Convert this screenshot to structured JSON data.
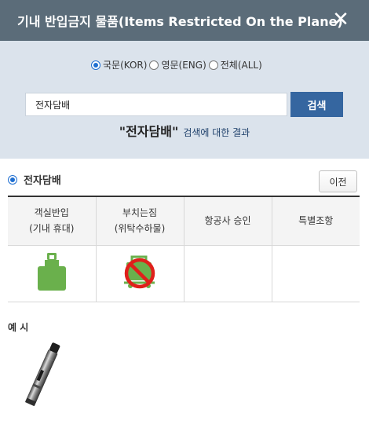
{
  "header": {
    "title": "기내 반입금지 물품(Items Restricted On the Plane)",
    "close_icon": "close-icon"
  },
  "search": {
    "languages": [
      {
        "label": "국문(KOR)",
        "selected": true
      },
      {
        "label": "영문(ENG)",
        "selected": false
      },
      {
        "label": "전체(ALL)",
        "selected": false
      }
    ],
    "query": "전자담배",
    "button_label": "검색",
    "result_query": "\"전자담배\"",
    "result_suffix": "검색에 대한 결과"
  },
  "item": {
    "name": "전자담배",
    "prev_label": "이전",
    "columns": [
      {
        "line1": "객실반입",
        "line2": "(기내 휴대)"
      },
      {
        "line1": "부치는짐",
        "line2": "(위탁수하물)"
      },
      {
        "line1": "항공사 승인",
        "line2": ""
      },
      {
        "line1": "특별조항",
        "line2": ""
      }
    ],
    "icons": [
      "carry-on-allowed-icon",
      "checked-baggage-prohibited-icon",
      "",
      ""
    ],
    "colors": {
      "allowed": "#6ab04c",
      "prohibited": "#e0201b"
    }
  },
  "examples": {
    "label": "예 시",
    "image": "e-cigarette-image"
  },
  "colors": {
    "header_bg": "#5b6c79",
    "panel_bg": "#dbe3ec",
    "button_bg": "#3566a0",
    "radio_accent": "#1f6fd1"
  }
}
